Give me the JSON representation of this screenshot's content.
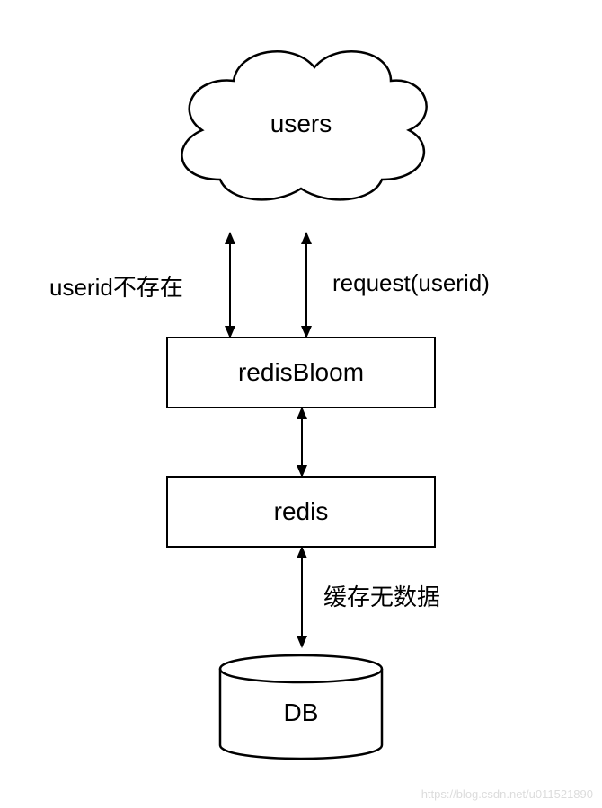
{
  "diagram": {
    "nodes": {
      "users": {
        "label": "users",
        "type": "cloud"
      },
      "redisbloom": {
        "label": "redisBloom",
        "type": "process-box"
      },
      "redis": {
        "label": "redis",
        "type": "process-box"
      },
      "db": {
        "label": "DB",
        "type": "datastore"
      }
    },
    "edges": {
      "users_to_bloom_left": {
        "label": "userid不存在",
        "from": "users",
        "to": "redisbloom",
        "bidirectional": true
      },
      "users_to_bloom_right": {
        "label": "request(userid)",
        "from": "users",
        "to": "redisbloom",
        "bidirectional": true
      },
      "bloom_to_redis": {
        "from": "redisbloom",
        "to": "redis",
        "bidirectional": true
      },
      "redis_to_db": {
        "label": "缓存无数据",
        "from": "redis",
        "to": "db",
        "bidirectional": true
      }
    }
  },
  "watermark": "https://blog.csdn.net/u011521890"
}
